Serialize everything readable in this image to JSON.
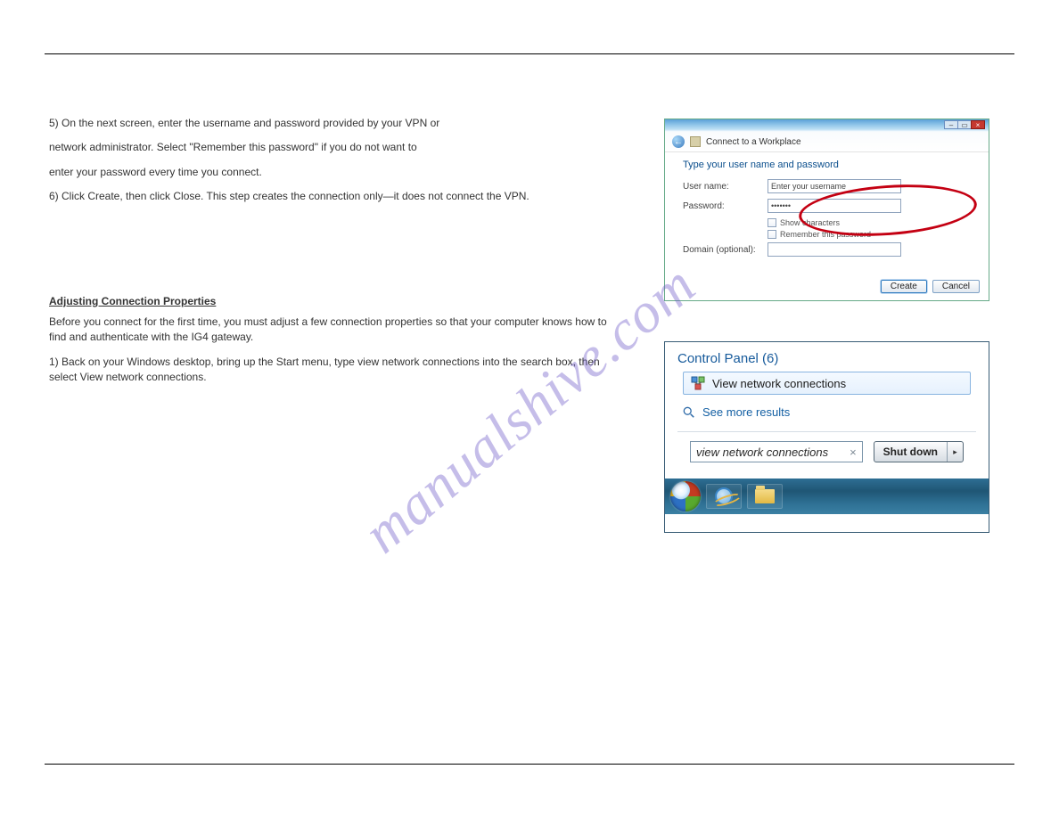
{
  "instructions": {
    "step5_a": "5)  On the next screen, enter the username and password provided by your VPN or",
    "step5_b": "network administrator. Select \"Remember this password\" if you do not want to",
    "step5_c": "enter your password every time you connect.",
    "step6": "6)  Click Create, then click Close. This step creates the connection only—it does not connect the VPN.",
    "section2_head": "Adjusting Connection Properties",
    "section2_p1": "Before you connect for the first time, you must adjust a few connection properties so that your computer knows how to find and authenticate with the IG4 gateway.",
    "section2_steps": "1)  Back on your Windows desktop, bring up the Start menu, type view network connections into the search box, then select View network connections."
  },
  "dialog1": {
    "crumb": "Connect to a Workplace",
    "prompt": "Type your user name and password",
    "username_label": "User name:",
    "username_value": "Enter your username",
    "password_label": "Password:",
    "password_value": "•••••••",
    "show_chars": "Show characters",
    "remember": "Remember this password",
    "domain_label": "Domain (optional):",
    "create_btn": "Create",
    "cancel_btn": "Cancel",
    "win_min": "–",
    "win_max": "▭",
    "win_close": "×"
  },
  "dialog2": {
    "cp_head": "Control Panel (6)",
    "result": "View network connections",
    "see_more": "See more results",
    "search_value": "view network connections",
    "clear": "×",
    "shutdown": "Shut down",
    "arrow": "▸"
  },
  "watermark": "manualshive.com"
}
